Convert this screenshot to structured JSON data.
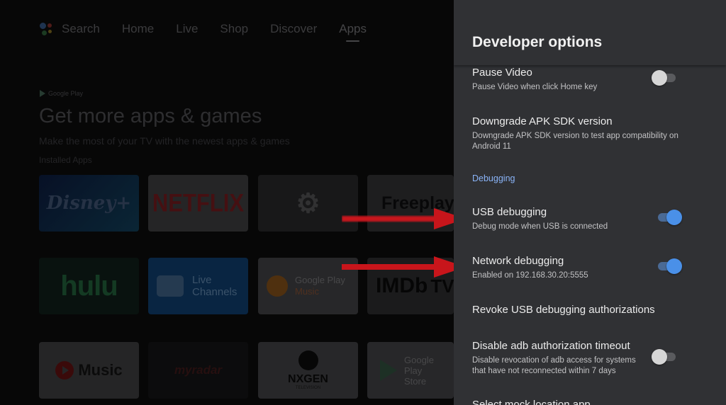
{
  "nav": {
    "items": [
      "Search",
      "Home",
      "Live",
      "Shop",
      "Discover",
      "Apps"
    ],
    "active": "Apps"
  },
  "hero": {
    "badge": "Google Play",
    "title": "Get more apps & games",
    "subtitle": "Make the most of your TV with the newest apps & games",
    "section_label": "Installed Apps"
  },
  "apps": {
    "disney": "Disney+",
    "netflix": "NETFLIX",
    "settings": "Settings",
    "freeplay": "Freeplay",
    "hulu": "hulu",
    "live_channels_1": "Live",
    "live_channels_2": "Channels",
    "play_music_1": "Google Play",
    "play_music_2": "Music",
    "imdb": "IMDb",
    "imdb_tv": "TV",
    "yt_music": "Music",
    "myradar": "myradar",
    "nxgen": "NXGEN",
    "nxgen_sub": "TELEVISION",
    "play_store_1": "Google Play",
    "play_store_2": "Store"
  },
  "panel": {
    "title": "Developer options",
    "rows": {
      "pause_video": {
        "title": "Pause Video",
        "subtitle": "Pause Video when click Home key",
        "toggle": "off"
      },
      "downgrade": {
        "title": "Downgrade APK SDK version",
        "subtitle_1": "Downgrade APK SDK version to test app compatibility on",
        "subtitle_2": "Android 11"
      },
      "section": "Debugging",
      "usb": {
        "title": "USB debugging",
        "subtitle": "Debug mode when USB is connected",
        "toggle": "on"
      },
      "network": {
        "title": "Network debugging",
        "subtitle": "Enabled on 192.168.30.20:5555",
        "toggle": "on"
      },
      "revoke": {
        "title": "Revoke USB debugging authorizations"
      },
      "adb_timeout": {
        "title": "Disable adb authorization timeout",
        "subtitle_1": "Disable revocation of adb access for systems",
        "subtitle_2": "that have not reconnected within 7 days",
        "toggle": "off"
      },
      "mock": {
        "title": "Select mock location app"
      }
    }
  },
  "colors": {
    "panel_bg": "#303134",
    "accent_blue": "#8ab4f8",
    "toggle_on": "#4a90e8",
    "arrow_red": "#c8151b"
  }
}
